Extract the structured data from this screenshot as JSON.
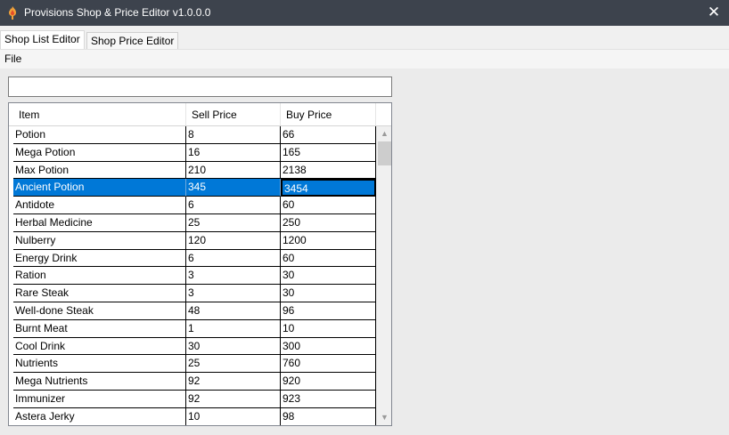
{
  "window": {
    "title": "Provisions Shop & Price Editor v1.0.0.0",
    "close_glyph": "✕"
  },
  "tabs": [
    {
      "label": "Shop List Editor",
      "active": true
    },
    {
      "label": "Shop Price Editor",
      "active": false
    }
  ],
  "menu": {
    "file_label": "File"
  },
  "search": {
    "value": "",
    "placeholder": ""
  },
  "grid": {
    "columns": [
      "Item",
      "Sell Price",
      "Buy Price"
    ],
    "selected_row": 3,
    "rows": [
      {
        "item": "Potion",
        "sell": "8",
        "buy": "66"
      },
      {
        "item": "Mega Potion",
        "sell": "16",
        "buy": "165"
      },
      {
        "item": "Max Potion",
        "sell": "210",
        "buy": "2138"
      },
      {
        "item": "Ancient Potion",
        "sell": "345",
        "buy": "3454"
      },
      {
        "item": "Antidote",
        "sell": "6",
        "buy": "60"
      },
      {
        "item": "Herbal Medicine",
        "sell": "25",
        "buy": "250"
      },
      {
        "item": "Nulberry",
        "sell": "120",
        "buy": "1200"
      },
      {
        "item": "Energy Drink",
        "sell": "6",
        "buy": "60"
      },
      {
        "item": "Ration",
        "sell": "3",
        "buy": "30"
      },
      {
        "item": "Rare Steak",
        "sell": "3",
        "buy": "30"
      },
      {
        "item": "Well-done Steak",
        "sell": "48",
        "buy": "96"
      },
      {
        "item": "Burnt Meat",
        "sell": "1",
        "buy": "10"
      },
      {
        "item": "Cool Drink",
        "sell": "30",
        "buy": "300"
      },
      {
        "item": "Nutrients",
        "sell": "25",
        "buy": "760"
      },
      {
        "item": "Mega Nutrients",
        "sell": "92",
        "buy": "920"
      },
      {
        "item": "Immunizer",
        "sell": "92",
        "buy": "923"
      },
      {
        "item": "Astera Jerky",
        "sell": "10",
        "buy": "98"
      }
    ]
  },
  "icons": {
    "app": "flame-icon",
    "scroll_up": "chevron-up-icon",
    "scroll_down": "chevron-down-icon"
  },
  "colors": {
    "titlebar": "#3d434d",
    "selection": "#0078d7"
  }
}
